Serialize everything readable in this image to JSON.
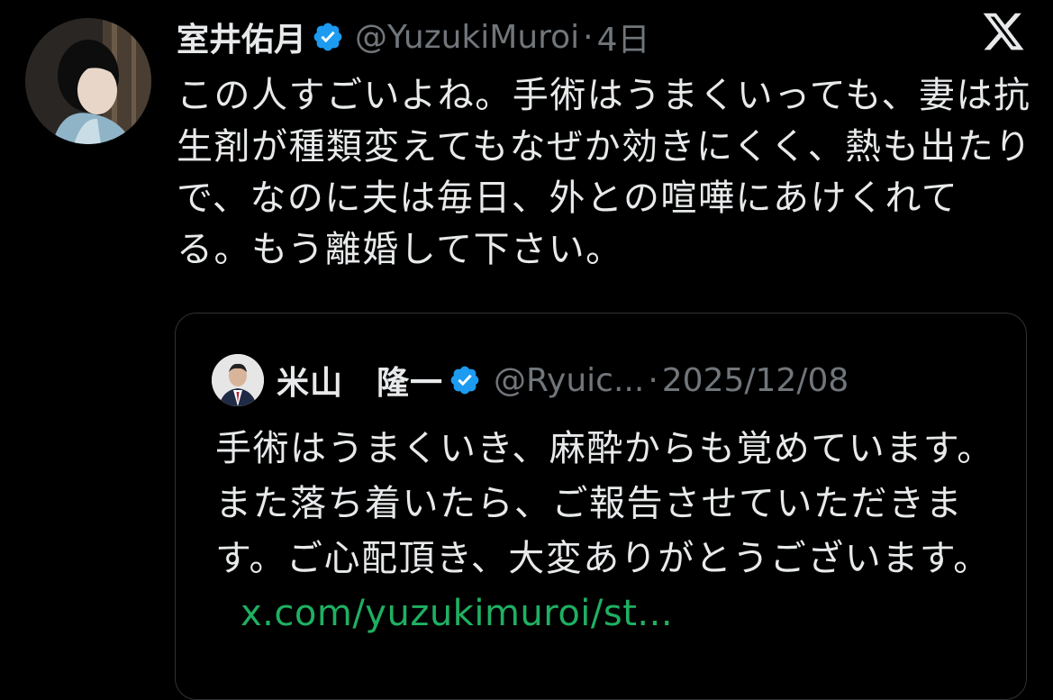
{
  "tweet": {
    "author": {
      "display_name": "室井佑月",
      "handle": "@YuzukiMuroi",
      "verified": true
    },
    "separator": "·",
    "timestamp": "4日",
    "text": "この人すごいよね。手術はうまくいっても、妻は抗生剤が種類変えてもなぜか効きにくく、熱も出たりで、なのに夫は毎日、外との喧嘩にあけくれてる。もう離婚して下さい。",
    "quote": {
      "author": {
        "display_name": "米山　隆一",
        "handle": "@Ryuic...",
        "verified": true
      },
      "separator": "·",
      "timestamp": "2025/12/08",
      "text": "手術はうまくいき、麻酔からも覚めています。また落ち着いたら、ご報告させていただきます。ご心配頂き、大変ありがとうございます。",
      "link": "x.com/yuzukimuroi/st..."
    }
  },
  "icons": {
    "brand": "x-logo-icon",
    "verified": "verified-badge-icon"
  },
  "colors": {
    "background": "#000000",
    "text": "#e7e9ea",
    "secondary": "#71767b",
    "verified_badge": "#1d9bf0",
    "link": "#1fb062",
    "quote_border": "#2f3336"
  }
}
